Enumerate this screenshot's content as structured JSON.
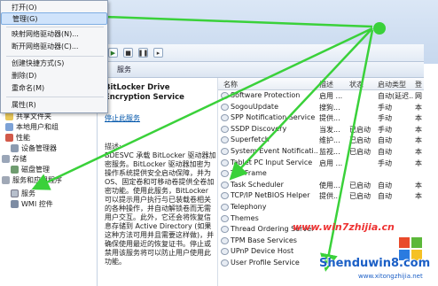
{
  "context_menu": {
    "items": [
      {
        "label": "打开(O)"
      },
      {
        "label": "管理(G)",
        "highlighted": true
      },
      {
        "label": "映射网络驱动器(N)..."
      },
      {
        "label": "断开网络驱动器(C)..."
      },
      {
        "label": "创建快捷方式(S)"
      },
      {
        "label": "删除(D)"
      },
      {
        "label": "重命名(M)"
      },
      {
        "label": "属性(R)"
      }
    ]
  },
  "services_panel": {
    "header": "服务"
  },
  "tree": {
    "items": [
      {
        "label": "共享文件夹"
      },
      {
        "label": "本地用户和组"
      },
      {
        "label": "性能"
      },
      {
        "label": "设备管理器"
      },
      {
        "label": "存储"
      },
      {
        "label": "磁盘管理"
      },
      {
        "label": "服务和应用程序"
      },
      {
        "label": "服务"
      },
      {
        "label": "WMI 控件"
      }
    ]
  },
  "description": {
    "title": "BitLocker Drive Encryption Service",
    "stop_link": "停止此服务",
    "label": "描述:",
    "body": "BDESVC 承载 BitLocker 驱动器加密服务。BitLocker 驱动器加密为操作系统提供安全启动保障，并为 OS、固定卷和可移动卷提供全卷加密功能。使用此服务，BitLocker 可以提示用户执行与已装载卷相关的各种操作，并自动解锁卷而无需用户交互。此外，它还会将恢复信息存储到 Active Directory (如果这种方法可用并且需要这样做)，并确保使用最近的恢复证书。停止或禁用该服务将可以防止用户使用此功能。"
  },
  "list": {
    "columns": [
      "名称",
      "描述",
      "状态",
      "启动类型",
      "登"
    ],
    "rows": [
      {
        "name": "Software Protection",
        "desc": "启用 ...",
        "status": "",
        "startup": "自动(延迟...",
        "logon": "网"
      },
      {
        "name": "SogouUpdate",
        "desc": "搜狗...",
        "status": "",
        "startup": "手动",
        "logon": "本"
      },
      {
        "name": "SPP Notification Service",
        "desc": "提供...",
        "status": "",
        "startup": "手动",
        "logon": "本"
      },
      {
        "name": "SSDP Discovery",
        "desc": "当发...",
        "status": "已启动",
        "startup": "手动",
        "logon": "本"
      },
      {
        "name": "Superfetch",
        "desc": "维护...",
        "status": "已启动",
        "startup": "自动",
        "logon": "本"
      },
      {
        "name": "System Event Notificati...",
        "desc": "监视...",
        "status": "已启动",
        "startup": "自动",
        "logon": "本"
      },
      {
        "name": "Tablet PC Input Service",
        "desc": "启用 ...",
        "status": "",
        "startup": "手动",
        "logon": "本"
      },
      {
        "name": "TAOFrame",
        "desc": "",
        "status": "",
        "startup": "",
        "logon": ""
      },
      {
        "name": "Task Scheduler",
        "desc": "使用...",
        "status": "已启动",
        "startup": "自动",
        "logon": "本"
      },
      {
        "name": "TCP/IP NetBIOS Helper",
        "desc": "提供...",
        "status": "已启动",
        "startup": "自动",
        "logon": "本"
      },
      {
        "name": "Telephony",
        "desc": "",
        "status": "",
        "startup": "",
        "logon": ""
      },
      {
        "name": "Themes",
        "desc": "",
        "status": "",
        "startup": "",
        "logon": ""
      },
      {
        "name": "Thread Ordering Server",
        "desc": "",
        "status": "",
        "startup": "",
        "logon": ""
      },
      {
        "name": "TPM Base Services",
        "desc": "",
        "status": "",
        "startup": "",
        "logon": ""
      },
      {
        "name": "UPnP Device Host",
        "desc": "",
        "status": "",
        "startup": "",
        "logon": ""
      },
      {
        "name": "User Profile Service",
        "desc": "",
        "status": "",
        "startup": "",
        "logon": ""
      }
    ]
  },
  "watermark": {
    "site_top": "www.win7zhijia.cn",
    "brand": "Shenduwin8.com",
    "url": "www.xitongzhijia.net"
  },
  "colors": {
    "arrow": "#3ad13a",
    "highlight": "#cfe3fb",
    "watermark": "#1b5fc6"
  }
}
